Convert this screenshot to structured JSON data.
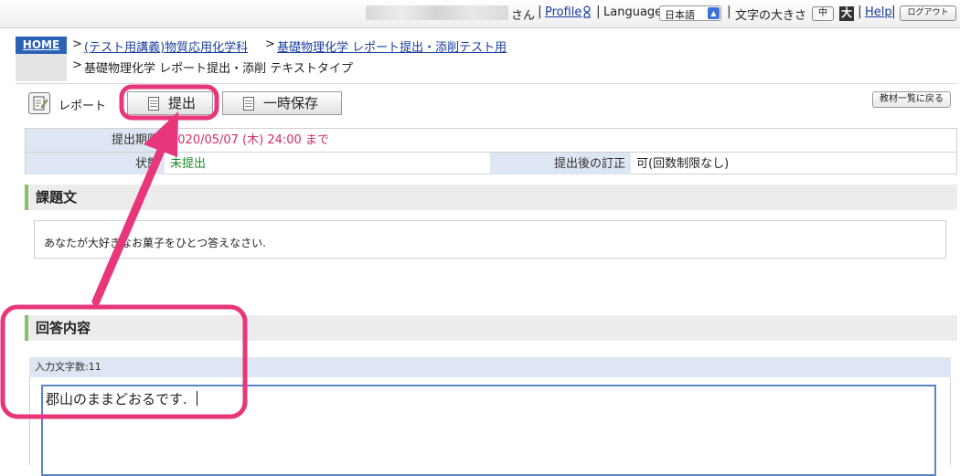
{
  "topbar": {
    "san": "さん",
    "profile": "Profile",
    "language_label": "Language",
    "language_value": "日本語",
    "font_size_label": "文字の大きさ",
    "size_mid": "中",
    "size_large": "大",
    "help": "Help",
    "logout": "ログアウト"
  },
  "breadcrumb": {
    "home": "HOME",
    "item1": "(テスト用講義)物質応用化学科",
    "item2": "基礎物理化学 レポート提出・添削テスト用",
    "current": "基礎物理化学 レポート提出・添削 テキストタイプ"
  },
  "toolbar": {
    "report_label": "レポート",
    "submit": "提出",
    "temp_save": "一時保存",
    "back": "教材一覧に戻る"
  },
  "info": {
    "deadline_label": "提出期限",
    "deadline_value": "2020/05/07 (木) 24:00 まで",
    "status_label": "状態",
    "status_value": "未提出",
    "correction_label": "提出後の訂正",
    "correction_value": "可(回数制限なし)"
  },
  "task": {
    "heading": "課題文",
    "text": "あなたが大好きなお菓子をひとつ答えなさい."
  },
  "answer": {
    "heading": "回答内容",
    "count_label": "入力文字数:11",
    "text": "郡山のままどおるです."
  },
  "colors": {
    "highlight": "#e8367a",
    "home_bg": "#2a63b5",
    "label_bg": "#dde6f2",
    "section_accent": "#88c06b"
  }
}
